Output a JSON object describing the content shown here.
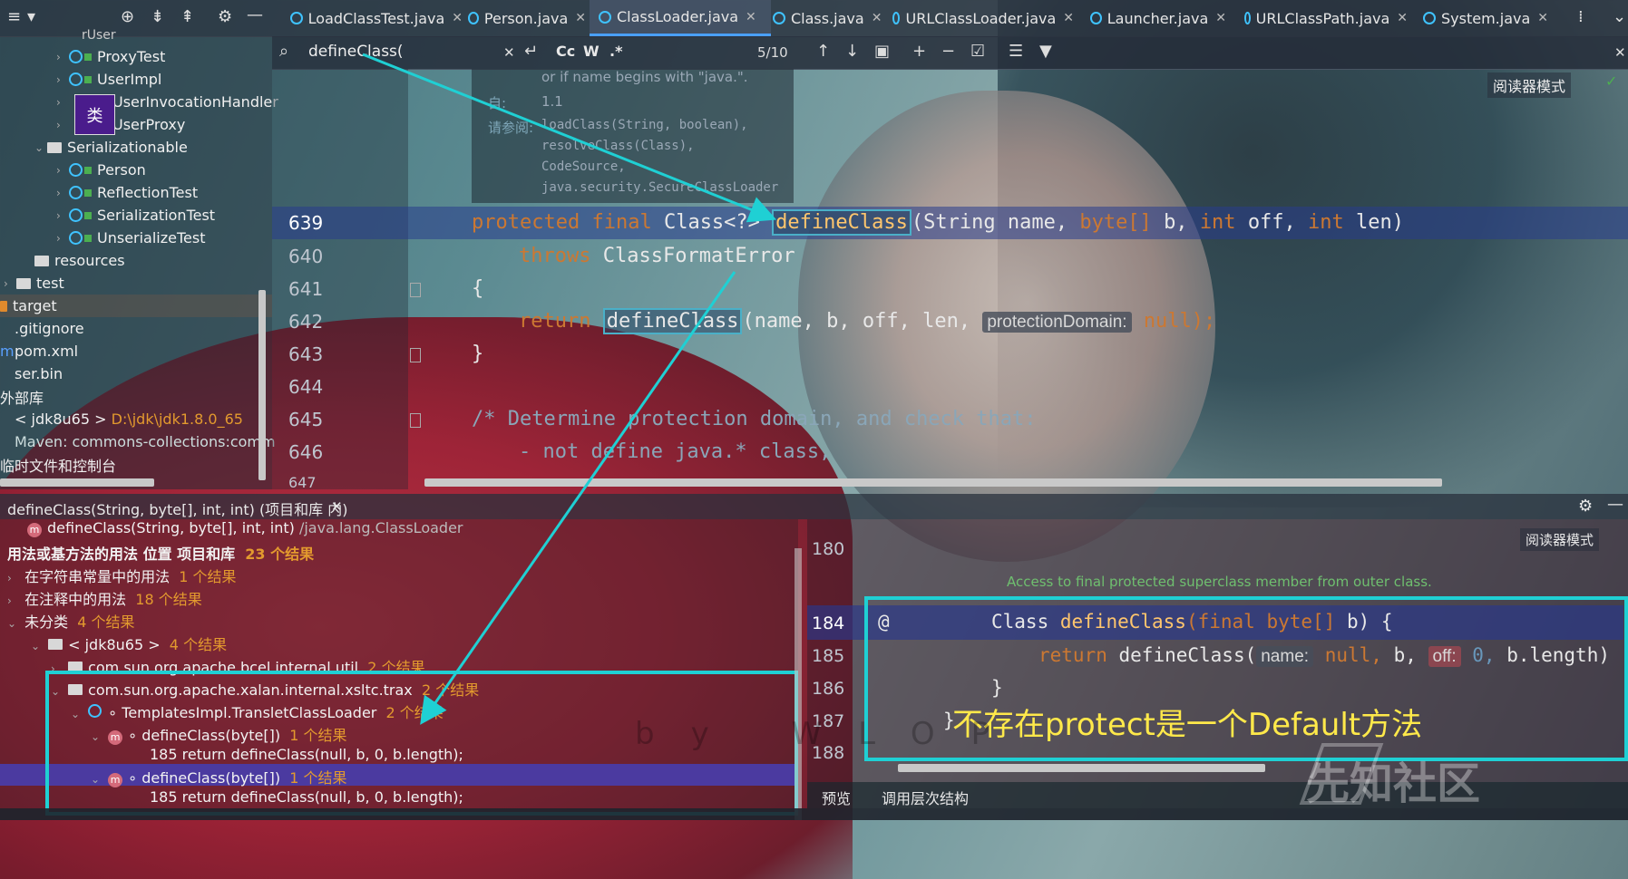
{
  "left_toolbar": {
    "chevron": "▾",
    "icons": [
      "target-icon",
      "collapse-icon",
      "expand-icon",
      "gear-icon",
      "minimize-icon"
    ]
  },
  "tabs": [
    {
      "label": "LoadClassTest.java",
      "active": false
    },
    {
      "label": "Person.java",
      "active": false
    },
    {
      "label": "ClassLoader.java",
      "active": true
    },
    {
      "label": "Class.java",
      "active": false
    },
    {
      "label": "URLClassLoader.java",
      "active": false
    },
    {
      "label": "Launcher.java",
      "active": false
    },
    {
      "label": "URLClassPath.java",
      "active": false
    },
    {
      "label": "System.java",
      "active": false
    }
  ],
  "search": {
    "value": "defineClass(",
    "match_count": "5/10",
    "toggle_cc": "Cc",
    "toggle_w": "W",
    "toggle_regex": ".*"
  },
  "reader_mode": "阅读器模式",
  "tree": [
    {
      "label": "ProxyTest",
      "indent": 1,
      "kind": "class"
    },
    {
      "label": "UserImpl",
      "indent": 1,
      "kind": "class"
    },
    {
      "label": "UserInvocationHandler",
      "indent": 1,
      "kind": "class"
    },
    {
      "label": "UserProxy",
      "indent": 1,
      "kind": "class"
    },
    {
      "label": "Serializationable",
      "indent": 0,
      "kind": "folder"
    },
    {
      "label": "Person",
      "indent": 1,
      "kind": "class"
    },
    {
      "label": "ReflectionTest",
      "indent": 1,
      "kind": "class"
    },
    {
      "label": "SerializationTest",
      "indent": 1,
      "kind": "class"
    },
    {
      "label": "UnserializeTest",
      "indent": 1,
      "kind": "class"
    },
    {
      "label": "resources",
      "indent": -1,
      "kind": "folder"
    },
    {
      "label": "test",
      "indent": -2,
      "kind": "folder"
    },
    {
      "label": "target",
      "indent": -3,
      "kind": "folder-orange"
    },
    {
      "label": ".gitignore",
      "indent": -3,
      "kind": "file"
    },
    {
      "label": "pom.xml",
      "indent": -3,
      "kind": "file"
    },
    {
      "label": "ser.bin",
      "indent": -3,
      "kind": "file"
    },
    {
      "label": "外部库",
      "indent": -4,
      "kind": "text"
    },
    {
      "label": "< jdk8u65 >",
      "suffix": "D:\\jdk\\jdk1.8.0_65",
      "indent": -3,
      "kind": "lib"
    },
    {
      "label": "Maven: commons-collections:comm",
      "indent": -3,
      "kind": "lib"
    },
    {
      "label": "临时文件和控制台",
      "indent": -4,
      "kind": "text"
    }
  ],
  "tooltip_char": "类",
  "doc": {
    "line1": "or if name begins with \"java.\".",
    "since_label": "自:",
    "since_value": "1.1",
    "see_label": "请参阅:",
    "see": [
      "loadClass(String, boolean),",
      "resolveClass(Class),",
      "CodeSource,",
      "java.security.SecureClassLoader"
    ]
  },
  "editor": {
    "lines": [
      {
        "num": "639",
        "active": true
      },
      {
        "num": "640"
      },
      {
        "num": "641"
      },
      {
        "num": "642"
      },
      {
        "num": "643"
      },
      {
        "num": "644"
      },
      {
        "num": "645"
      },
      {
        "num": "646"
      },
      {
        "num": "647"
      }
    ],
    "l639": {
      "kw1": "protected",
      "kw2": "final",
      "type": "Class<?>",
      "fn": "defineClass",
      "p1t": "(String",
      "p1": "name,",
      "p2t": "byte[]",
      "p2": "b,",
      "p3t": "int",
      "p3": "off,",
      "p4t": "int",
      "p4": "len)"
    },
    "l640": {
      "kw": "throws",
      "rest": "ClassFormatError"
    },
    "l641": "{",
    "l642": {
      "kw": "return",
      "fn": "defineClass",
      "args": "(name, b, off, len,",
      "hint": "protectionDomain:",
      "tail": "null);"
    },
    "l643": "}",
    "l645": "/* Determine protection domain, and check that:",
    "l646": "- not define java.* class,"
  },
  "find_panel": {
    "title": "defineClass(String, byte[], int, int) (项目和库 内)",
    "target": "defineClass(String, byte[], int, int)",
    "target_path": "/java.lang.ClassLoader",
    "summary": "用法或基方法的用法 位置 项目和库",
    "summary_count": "23 个结果",
    "rows": [
      {
        "label": "在字符串常量中的用法",
        "count": "1 个结果"
      },
      {
        "label": "在注释中的用法",
        "count": "18 个结果"
      },
      {
        "label": "未分类",
        "count": "4 个结果"
      },
      {
        "label": "< jdk8u65 >",
        "count": "4 个结果"
      },
      {
        "label": "com.sun.org.apache.bcel.internal.util",
        "count": "2 个结果"
      },
      {
        "label": "com.sun.org.apache.xalan.internal.xsltc.trax",
        "count": "2 个结果"
      },
      {
        "label": "TemplatesImpl.TransletClassLoader",
        "count": "2 个结果"
      },
      {
        "label": "defineClass(byte[])",
        "count": "1 个结果"
      },
      {
        "label": "185 return defineClass(null, b, 0, b.length);",
        "count": ""
      },
      {
        "label": "defineClass(byte[])",
        "count": "1 个结果"
      },
      {
        "label": "185 return defineClass(null, b, 0, b.length);",
        "count": ""
      }
    ]
  },
  "preview": {
    "reader_mode": "阅读器模式",
    "doc_line": "Access to final protected superclass member from outer class.",
    "lines": [
      "180",
      "184",
      "185",
      "186",
      "187",
      "188"
    ],
    "l184": {
      "at": "@",
      "type": "Class",
      "fn": "defineClass",
      "args1": "(final",
      "args2": "byte[]",
      "args3": "b) {"
    },
    "l185": {
      "kw": "return",
      "fn": "defineClass(",
      "hint1": "name:",
      "v1": "null,",
      "b": "b,",
      "hint2": "off:",
      "v2": "0,",
      "tail": "b.length)"
    },
    "l186": "}",
    "l187": "}",
    "annotation": "不存在protect是一个Default方法"
  },
  "bottom_tabs": [
    "预览",
    "调用层次结构"
  ],
  "watermark": "先知社区",
  "byline": "by WLOP",
  "colors": {
    "accent": "#1fd0d4",
    "keyword": "#cc7832",
    "function": "#ffc66d",
    "count": "#e39a2e",
    "annotation": "#ffe94a"
  }
}
